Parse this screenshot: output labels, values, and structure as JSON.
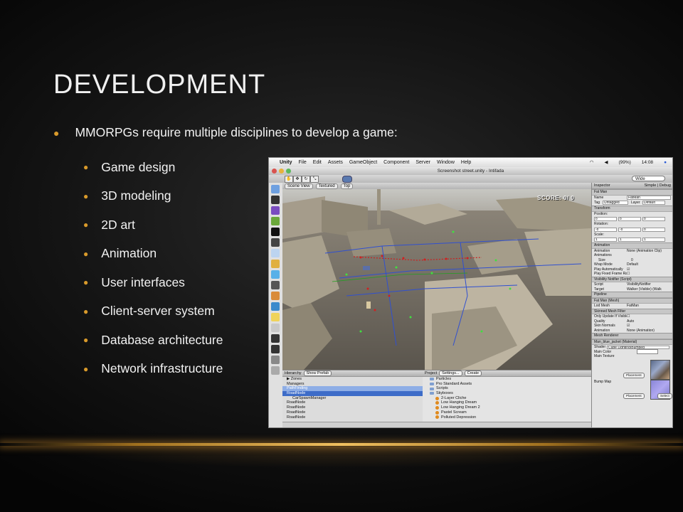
{
  "slide": {
    "title": "DEVELOPMENT",
    "main_bullet": "MMORPGs require multiple disciplines to develop a game:",
    "sub_bullets": [
      "Game design",
      "3D modeling",
      "2D art",
      "Animation",
      "User interfaces",
      "Client-server system",
      "Database architecture",
      "Network infrastructure"
    ],
    "accent_color": "#d99a2b"
  },
  "unity": {
    "menubar": {
      "app": "Unity",
      "items": [
        "File",
        "Edit",
        "Assets",
        "GameObject",
        "Component",
        "Server",
        "Window",
        "Help"
      ],
      "battery": "(99%)",
      "clock": "14:08"
    },
    "window_title": "Screenshot street.unity - Intifada",
    "layout_label": "Wide",
    "scene": {
      "tab_label": "Scene View",
      "mode_label": "Textured",
      "view_label": "Top",
      "score_text": "SCORE: 0/ 0"
    },
    "inspector": {
      "tab": "Inspector",
      "simple_label": "Simple",
      "debug_label": "Debug",
      "object_title": "Fat Man",
      "name_label": "Name",
      "name_value": "FatMan",
      "tag_label": "Tag",
      "tag_value": "Untagged",
      "layer_label": "Layer",
      "layer_value": "Default",
      "transform_title": "Transform",
      "position_label": "Position:",
      "position": [
        "0",
        "0",
        "0"
      ],
      "rotation_label": "Rotation:",
      "rotation": [
        "-0",
        "-0",
        "0"
      ],
      "scale_label": "Scale:",
      "scale": [
        "1",
        "1",
        "1"
      ],
      "animation_title": "Animation",
      "animation_rows": [
        {
          "label": "Animation",
          "value": "None (Animation Clip)"
        },
        {
          "label": "Animations",
          "value": ""
        },
        {
          "label": "Size",
          "value": "0"
        },
        {
          "label": "Wrap Mode",
          "value": "Default"
        },
        {
          "label": "Play Automatically",
          "value": ""
        },
        {
          "label": "Play Fixed Frame Rate",
          "value": ""
        }
      ],
      "visibility_title": "Visibility Notifier (Script)",
      "visibility_rows": [
        {
          "label": "Script",
          "value": "VisibilityNotifier"
        },
        {
          "label": "Target",
          "value": "Walker (Visible) (Walk"
        }
      ],
      "pipeline_title": "Pipeline",
      "mesh_title": "Fat Man (Mesh)",
      "mesh_rows": [
        {
          "label": "Lod Mesh",
          "value": "FatMan"
        }
      ],
      "skinned_title": "Skinned Mesh Filter",
      "skinned_rows": [
        {
          "label": "Only Update If Visible",
          "value": ""
        },
        {
          "label": "Quality",
          "value": "Auto"
        },
        {
          "label": "Skin Normals",
          "value": ""
        },
        {
          "label": "Animation",
          "value": "None (Animation)"
        }
      ],
      "renderer_title": "Mesh Renderer",
      "material_title": "Man_blue_jacket (Material)",
      "shader_label": "Shader",
      "shader_value": "Cube Lighting/Bumped",
      "main_color_label": "Main Color",
      "main_texture_label": "Main Texture",
      "bump_map_label": "Bump Map",
      "placement_label": "Placement",
      "select_label": "Select"
    },
    "hierarchy": {
      "tab": "Hierarchy",
      "show_prefab": "Show Prefab",
      "rows": [
        {
          "text": "▶ Zones",
          "state": "normal"
        },
        {
          "text": "Managers",
          "state": "normal"
        },
        {
          "text": "PathFinding",
          "state": "sel2"
        },
        {
          "text": "RoadNode",
          "state": "sel"
        },
        {
          "text": "CarSpawnManager",
          "state": "normal"
        },
        {
          "text": "RoadNode",
          "state": "normal"
        },
        {
          "text": "RoadNode",
          "state": "normal"
        },
        {
          "text": "RoadNode",
          "state": "normal"
        },
        {
          "text": "RoadNode",
          "state": "normal"
        }
      ]
    },
    "project": {
      "tab": "Project",
      "settings": "Settings...",
      "create": "Create",
      "rows": [
        {
          "text": "Particles",
          "icon": "folder"
        },
        {
          "text": "Pro Standard Assets",
          "icon": "folder"
        },
        {
          "text": "Scripts",
          "icon": "folder"
        },
        {
          "text": "Skyboxes",
          "icon": "folder"
        },
        {
          "text": "2-Layer Cliche",
          "icon": "sky"
        },
        {
          "text": "Low Hanging Dream",
          "icon": "sky"
        },
        {
          "text": "Low Hanging Dream 2",
          "icon": "sky"
        },
        {
          "text": "Pastel Scream",
          "icon": "sky"
        },
        {
          "text": "Polluted Depression",
          "icon": "sky"
        }
      ]
    }
  }
}
